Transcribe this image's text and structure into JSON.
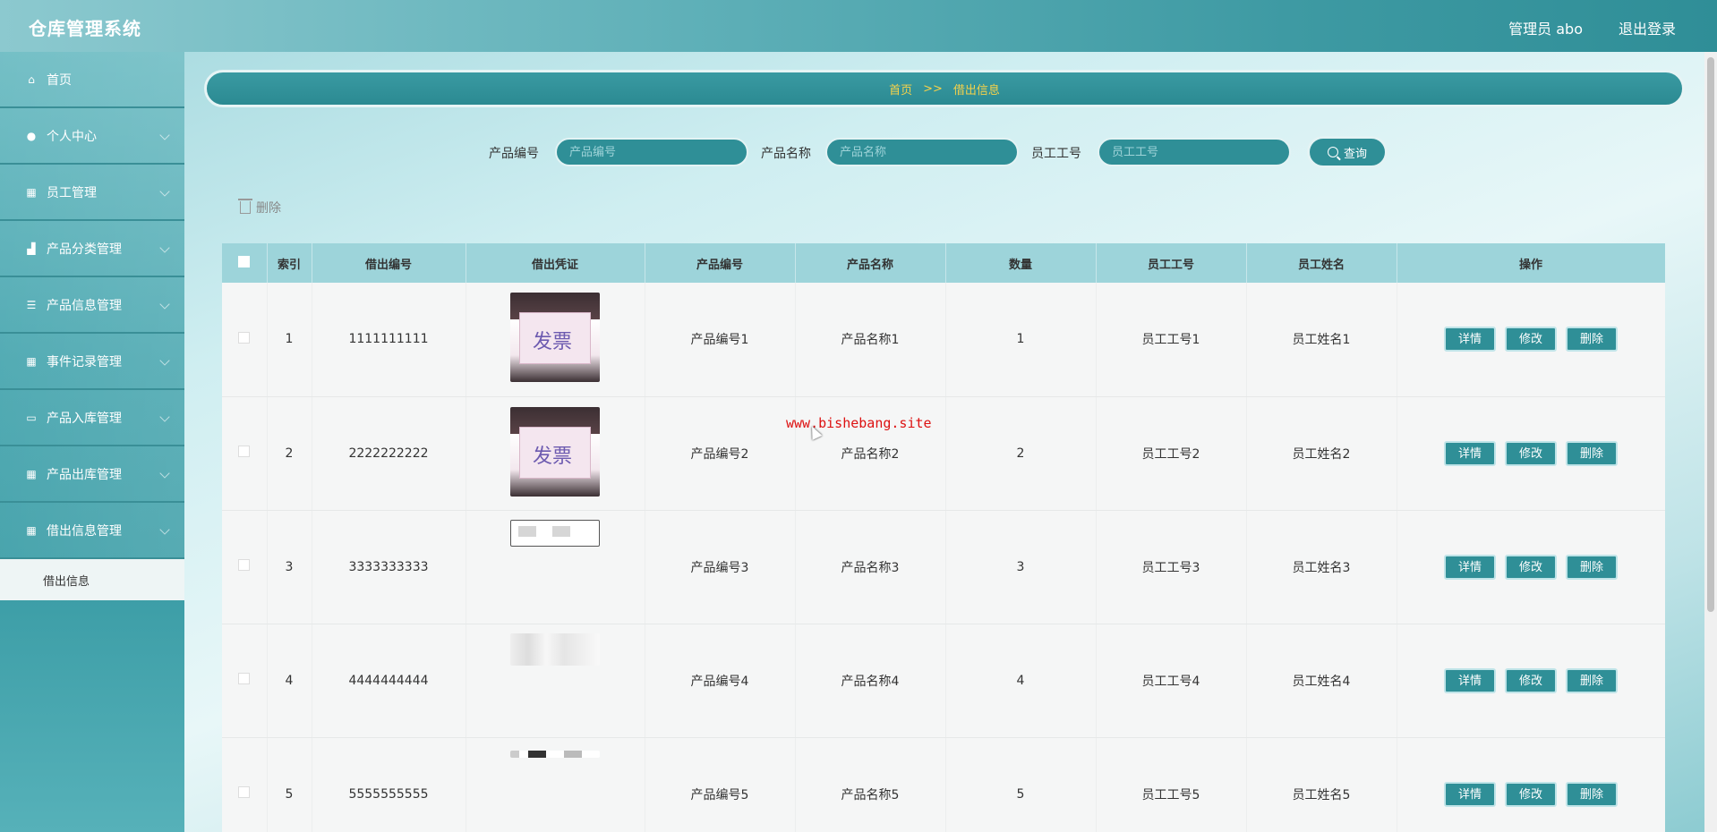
{
  "header": {
    "brand": "仓库管理系统",
    "user": "管理员 abo",
    "logout": "退出登录"
  },
  "sidebar": {
    "items": [
      {
        "label": "首页",
        "icon": "home-icon",
        "glyph": "⌂",
        "chevron": false
      },
      {
        "label": "个人中心",
        "icon": "user-icon",
        "glyph": "●",
        "chevron": true
      },
      {
        "label": "员工管理",
        "icon": "grid-icon",
        "glyph": "▦",
        "chevron": true
      },
      {
        "label": "产品分类管理",
        "icon": "chart-icon",
        "glyph": "▟",
        "chevron": true
      },
      {
        "label": "产品信息管理",
        "icon": "list-icon",
        "glyph": "☰",
        "chevron": true
      },
      {
        "label": "事件记录管理",
        "icon": "grid-icon",
        "glyph": "▦",
        "chevron": true
      },
      {
        "label": "产品入库管理",
        "icon": "briefcase-icon",
        "glyph": "▭",
        "chevron": true
      },
      {
        "label": "产品出库管理",
        "icon": "grid-icon",
        "glyph": "▦",
        "chevron": true
      },
      {
        "label": "借出信息管理",
        "icon": "grid-icon",
        "glyph": "▦",
        "chevron": true
      }
    ],
    "sub_item": "借出信息"
  },
  "breadcrumb": {
    "home": "首页",
    "sep": ">>",
    "current": "借出信息"
  },
  "search": {
    "fields": [
      {
        "label": "产品编号",
        "placeholder": "产品编号"
      },
      {
        "label": "产品名称",
        "placeholder": "产品名称"
      },
      {
        "label": "员工工号",
        "placeholder": "员工工号"
      }
    ],
    "button": "查询"
  },
  "toolbar": {
    "delete": "删除"
  },
  "table": {
    "headers": [
      "索引",
      "借出编号",
      "借出凭证",
      "产品编号",
      "产品名称",
      "数量",
      "员工工号",
      "员工姓名",
      "操作"
    ],
    "rows": [
      {
        "index": "1",
        "code": "1111111111",
        "thumb": "photo",
        "pcode": "产品编号1",
        "pname": "产品名称1",
        "qty": "1",
        "eid": "员工工号1",
        "ename": "员工姓名1"
      },
      {
        "index": "2",
        "code": "2222222222",
        "thumb": "photo",
        "pcode": "产品编号2",
        "pname": "产品名称2",
        "qty": "2",
        "eid": "员工工号2",
        "ename": "员工姓名2"
      },
      {
        "index": "3",
        "code": "3333333333",
        "thumb": "doc",
        "pcode": "产品编号3",
        "pname": "产品名称3",
        "qty": "3",
        "eid": "员工工号3",
        "ename": "员工姓名3"
      },
      {
        "index": "4",
        "code": "4444444444",
        "thumb": "faint",
        "pcode": "产品编号4",
        "pname": "产品名称4",
        "qty": "4",
        "eid": "员工工号4",
        "ename": "员工姓名4"
      },
      {
        "index": "5",
        "code": "5555555555",
        "thumb": "strip",
        "pcode": "产品编号5",
        "pname": "产品名称5",
        "qty": "5",
        "eid": "员工工号5",
        "ename": "员工姓名5"
      }
    ],
    "actions": {
      "detail": "详情",
      "edit": "修改",
      "delete": "删除"
    },
    "photo_text": "发票"
  },
  "watermark": "www.bishebang.site"
}
